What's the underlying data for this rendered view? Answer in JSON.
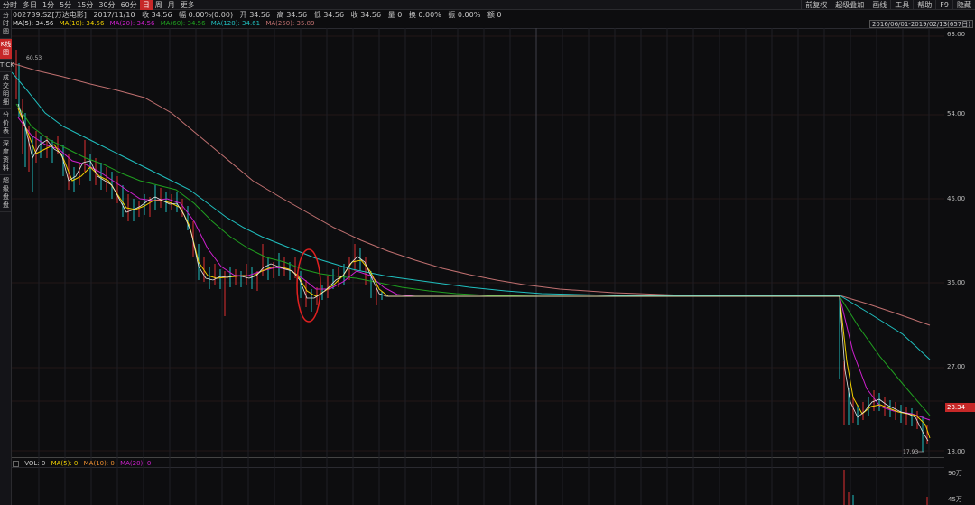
{
  "toolbar": {
    "periods": [
      "分时",
      "多日",
      "1分",
      "5分",
      "15分",
      "30分",
      "60分",
      "日",
      "周",
      "月",
      "更多"
    ],
    "active_period": "日",
    "right_buttons": [
      "前复权",
      "超级叠加",
      "画线",
      "工具",
      "帮助",
      "F9",
      "隐藏"
    ]
  },
  "sidebar": {
    "tabs": [
      "分时图",
      "K线图",
      "TICK",
      "成交明细",
      "分价表",
      "深度资料",
      "超级盘盘"
    ],
    "active_tab": "K线图"
  },
  "quote": {
    "code": "002739.SZ[万达电影]",
    "date": "2017/11/10",
    "close": "收 34.56",
    "change": "幅 0.00%(0.00)",
    "open": "开 34.56",
    "high": "高 34.56",
    "low": "低 34.56",
    "price": "收 34.56",
    "volume": "量 0",
    "turnover": "换 0.00%",
    "amplitude": "振 0.00%",
    "amount": "额 0"
  },
  "ma": {
    "ma5": "MA(5): 34.56",
    "ma10": "MA(10): 34.56",
    "ma20": "MA(20): 34.56",
    "ma60": "MA(60): 34.56",
    "ma120": "MA(120): 34.61",
    "ma250": "MA(250): 35.89"
  },
  "date_range": "2016/06/01-2019/02/13(657日)",
  "y_axis": [
    "63.00",
    "54.00",
    "45.00",
    "36.00",
    "27.00",
    "18.00"
  ],
  "current_price_tag": "23.34",
  "high_label": "60.53",
  "low_label": "17.93",
  "volume": {
    "legend_vol": "VOL: 0",
    "legend_ma5": "MA(5): 0",
    "legend_ma10": "MA(10): 0",
    "legend_ma20": "MA(20): 0",
    "axis": [
      "90万",
      "45万"
    ]
  },
  "colors": {
    "ma5": "#e6e6e6",
    "ma10": "#f0d000",
    "ma20": "#d020d0",
    "ma60": "#20a020",
    "ma120": "#20c0c0",
    "ma250": "#c07070",
    "up": "#e03030",
    "down": "#20c0c0",
    "annotation": "#e02020"
  }
}
